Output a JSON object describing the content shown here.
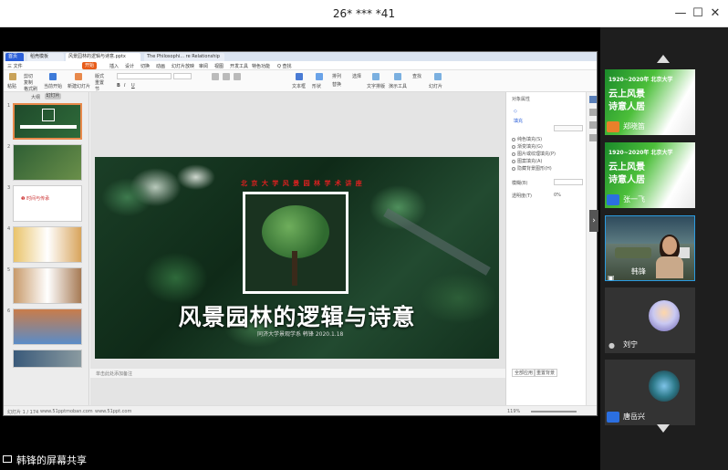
{
  "window": {
    "title": "26* *** *41",
    "controls": [
      "—",
      "☐",
      "✕"
    ]
  },
  "app": {
    "tabs": [
      {
        "label": "首页",
        "kind": "home"
      },
      {
        "label": "稻壳模板",
        "kind": "normal"
      },
      {
        "label": "风景园林的逻辑与诗意.pptx",
        "kind": "active"
      },
      {
        "label": "The Philosophi... re Relationship",
        "kind": "normal"
      }
    ],
    "menu": [
      "三 文件",
      "开始",
      "插入",
      "设计",
      "切换",
      "动画",
      "幻灯片放映",
      "审阅",
      "视图",
      "开发工具",
      "特色功能"
    ],
    "menu_right": "Q 查找",
    "ribbon": [
      "粘贴",
      "剪切",
      "复制",
      "格式刷",
      "当前开始",
      "新建幻灯片",
      "版式",
      "重置",
      "节",
      "文本框",
      "形状",
      "排列",
      "替换",
      "选择",
      "文字排版",
      "演示工具",
      "查找",
      "幻灯片"
    ],
    "thumb_panel": {
      "tab_outline": "大纲",
      "tab_slides": "幻灯片",
      "numbers": [
        "1",
        "2",
        "3",
        "4",
        "5",
        "6"
      ],
      "slide3_title": "❶ 时间与传承"
    },
    "slide": {
      "top_text": "北 京 大 学 风 景 园 林 学 术 讲 座",
      "title": "风景园林的逻辑与诗意",
      "subtitle": "同济大学景观学系  韩锋  2020.1.18"
    },
    "notes": "单击此处添加备注",
    "props": {
      "header": "对象属性",
      "section": "填充",
      "options": [
        "纯色填充(S)",
        "渐变填充(G)",
        "图片或纹理填充(P)",
        "图案填充(A)",
        "隐藏背景图形(H)"
      ],
      "transparency_label": "透明度(T)",
      "transparency_value": "0%",
      "blur_label": "模糊(B)",
      "apply_all": "全部应用",
      "reset": "重置背景"
    },
    "status": {
      "slide_pos": "幻灯片 1 / 174",
      "theme": "www.51pptmoban.com",
      "zoom": "119%",
      "url": "www.51ppt.com"
    }
  },
  "share_label": "韩锋的屏幕共享",
  "participants": [
    {
      "name": "郑晓笛",
      "type": "slide",
      "badge": "orange",
      "head": "1920~2020年 北京大学",
      "line1": "云上风景",
      "line2": "诗意人居"
    },
    {
      "name": "张一飞",
      "type": "slide",
      "badge": "blue",
      "head": "1920~2020年 北京大学",
      "line1": "云上风景",
      "line2": "诗意人居"
    },
    {
      "name": "韩锋",
      "type": "camera",
      "badge": "blue"
    },
    {
      "name": "刘宁",
      "type": "avatar",
      "badge": "gray"
    },
    {
      "name": "唐岳兴",
      "type": "avatar",
      "badge": "blue"
    }
  ],
  "colors": {
    "accent_orange": "#e85d1a",
    "accent_blue": "#2b6fe0",
    "slide_red": "#e02020"
  }
}
